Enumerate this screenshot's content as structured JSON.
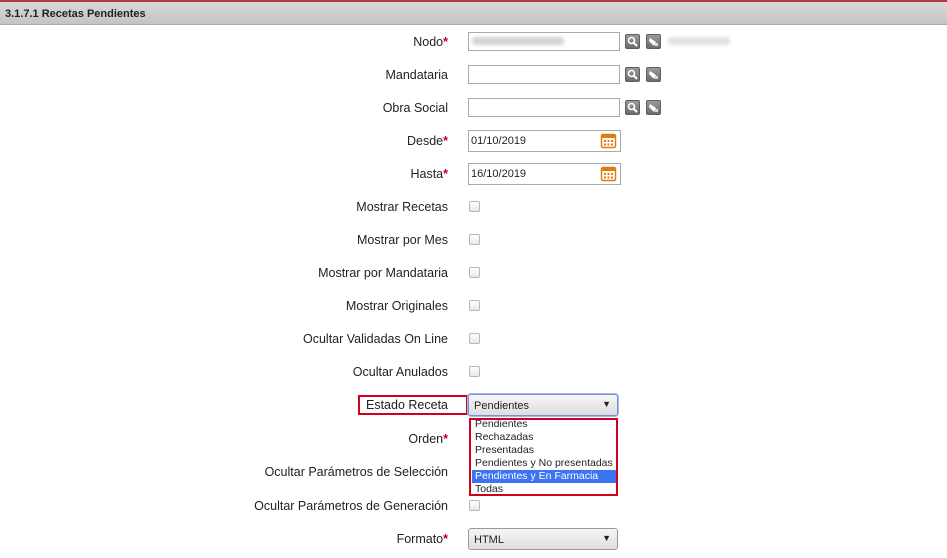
{
  "header": {
    "title": "3.1.7.1 Recetas Pendientes"
  },
  "fields": {
    "nodo": {
      "label": "Nodo",
      "required_mark": "*"
    },
    "mandataria": {
      "label": "Mandataria"
    },
    "obra_social": {
      "label": "Obra Social"
    },
    "desde": {
      "label": "Desde",
      "required_mark": "*",
      "value": "01/10/2019"
    },
    "hasta": {
      "label": "Hasta",
      "required_mark": "*",
      "value": "16/10/2019"
    }
  },
  "checkboxes": [
    {
      "label": "Mostrar Recetas",
      "checked": false
    },
    {
      "label": "Mostrar por Mes",
      "checked": false
    },
    {
      "label": "Mostrar por Mandataria",
      "checked": false
    },
    {
      "label": "Mostrar Originales",
      "checked": false
    },
    {
      "label": "Ocultar Validadas On Line",
      "checked": false
    },
    {
      "label": "Ocultar Anulados",
      "checked": false
    }
  ],
  "estado": {
    "label": "Estado Receta",
    "value": "Pendientes",
    "options": [
      "Pendientes",
      "Rechazadas",
      "Presentadas",
      "Pendientes y No presentadas",
      "Pendientes y En Farmacia",
      "Todas"
    ],
    "highlighted": "Pendientes y En Farmacia"
  },
  "orden": {
    "label": "Orden",
    "required_mark": "*"
  },
  "ocultar_seleccion": {
    "label": "Ocultar Parámetros de Selección"
  },
  "ocultar_generacion": {
    "label": "Ocultar Parámetros de Generación"
  },
  "formato": {
    "label": "Formato",
    "required_mark": "*",
    "value": "HTML"
  },
  "icons": {
    "search": "magnifier-icon",
    "clear": "eraser-icon",
    "calendar": "calendar-icon"
  },
  "colors": {
    "required": "#c0001a",
    "highlight_border": "#d0021b",
    "selected_option": "#3c73f1",
    "calendar": "#e07b10"
  }
}
